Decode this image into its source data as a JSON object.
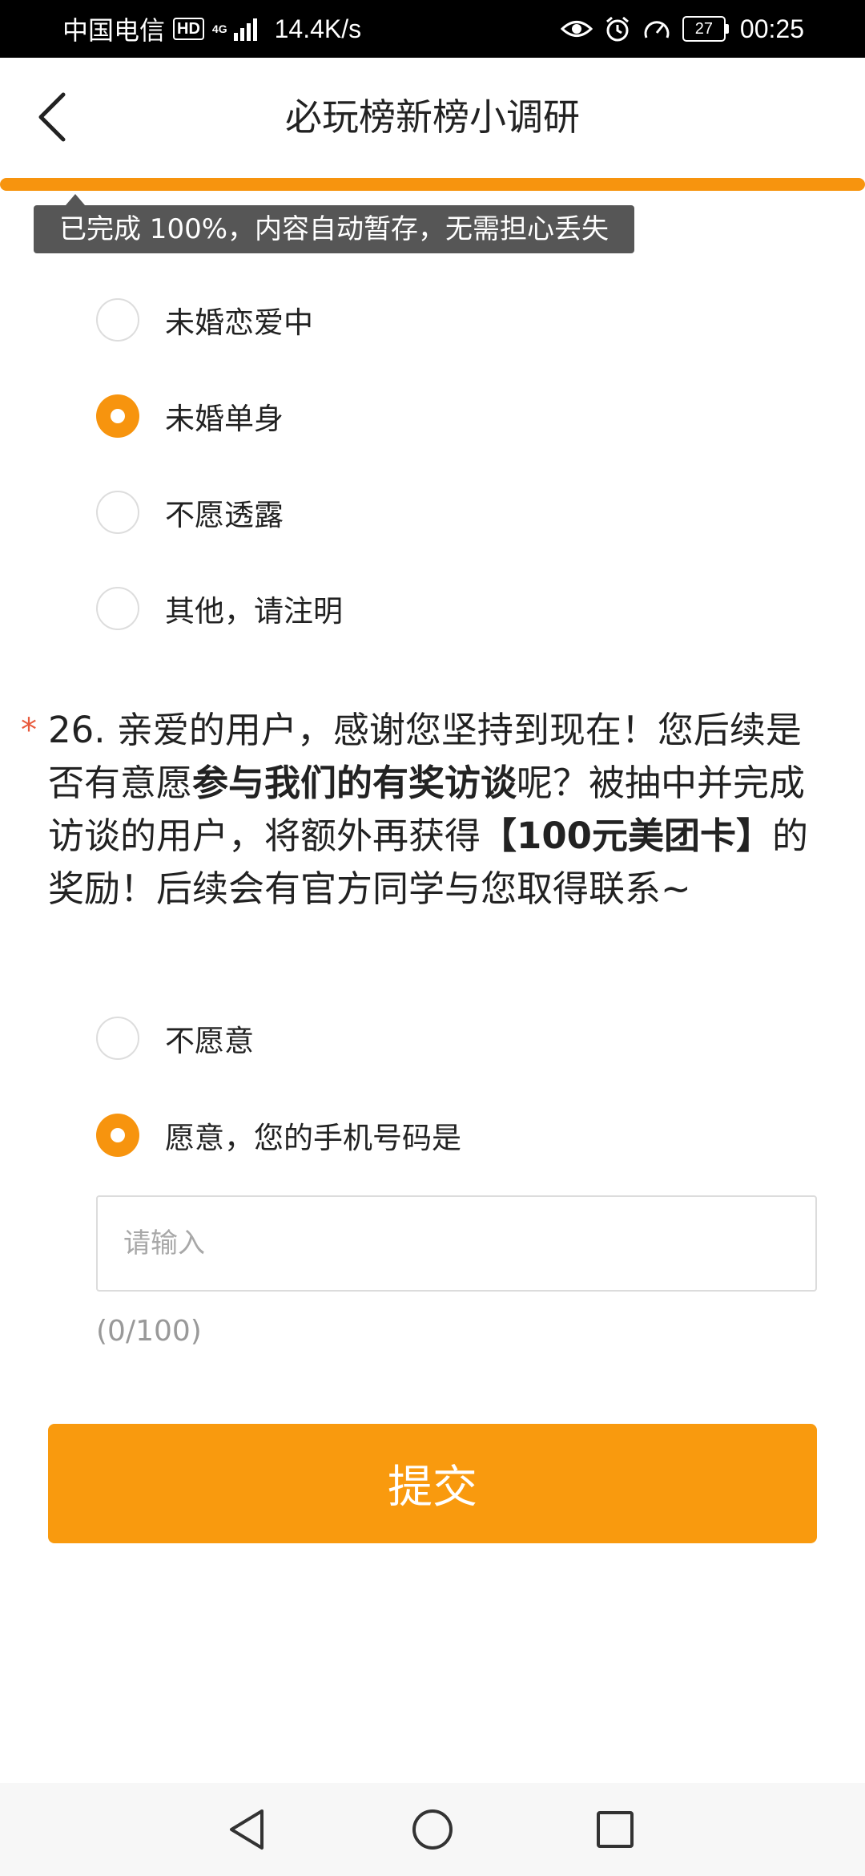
{
  "status_bar": {
    "carrier": "中国电信",
    "hd": "HD",
    "network": "4G",
    "speed": "14.4K/s",
    "battery": "27",
    "time": "00:25"
  },
  "header": {
    "title": "必玩榜新榜小调研"
  },
  "progress": {
    "percent": 100,
    "tooltip": "已完成 100%，内容自动暂存，无需担心丢失"
  },
  "q25": {
    "options": [
      {
        "label": "未婚恋爱中",
        "checked": false
      },
      {
        "label": "未婚单身",
        "checked": true
      },
      {
        "label": "不愿透露",
        "checked": false
      },
      {
        "label": "其他，请注明",
        "checked": false
      }
    ]
  },
  "q26": {
    "required_mark": "*",
    "text_1": "26. 亲爱的用户，感谢您坚持到现在！您后续是否有意愿",
    "bold_1": "参与我们的有奖访谈",
    "text_2": "呢？被抽中并完成访谈的用户，将额外再获得",
    "bold_2": "【100元美团卡】",
    "text_3": "的奖励！后续会有官方同学与您取得联系~",
    "options": [
      {
        "label": "不愿意",
        "checked": false
      },
      {
        "label": "愿意，您的手机号码是",
        "checked": true
      }
    ],
    "input_placeholder": "请输入",
    "input_value": "",
    "char_count": "(0/100)"
  },
  "submit_label": "提交",
  "colors": {
    "accent": "#f7940e",
    "required": "#e85a3c",
    "tooltip_bg": "#565656"
  }
}
